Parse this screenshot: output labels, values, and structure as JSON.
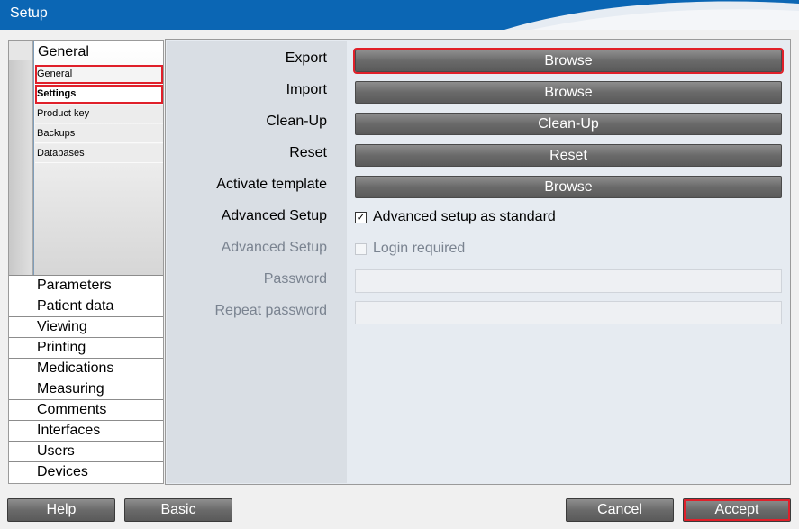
{
  "window": {
    "title": "Setup"
  },
  "nav": {
    "group_title": "General",
    "sub_items": [
      "General",
      "Settings",
      "Product key",
      "Backups",
      "Databases"
    ],
    "items": [
      "Parameters",
      "Patient data",
      "Viewing",
      "Printing",
      "Medications",
      "Measuring",
      "Comments",
      "Interfaces",
      "Users",
      "Devices"
    ]
  },
  "form": {
    "rows": [
      {
        "label": "Export",
        "button": "Browse"
      },
      {
        "label": "Import",
        "button": "Browse"
      },
      {
        "label": "Clean-Up",
        "button": "Clean-Up"
      },
      {
        "label": "Reset",
        "button": "Reset"
      },
      {
        "label": "Activate template",
        "button": "Browse"
      }
    ],
    "advanced_setup_label": "Advanced Setup",
    "advanced_setup_checkbox": "Advanced setup as standard",
    "advanced_setup_checked": true,
    "login_label": "Advanced Setup",
    "login_checkbox": "Login required",
    "login_checked": false,
    "password_label": "Password",
    "password_value": "",
    "repeat_password_label": "Repeat password",
    "repeat_password_value": ""
  },
  "footer": {
    "help": "Help",
    "basic": "Basic",
    "cancel": "Cancel",
    "accept": "Accept"
  },
  "colors": {
    "titlebar": "#0b66b4",
    "highlight": "#e0202a"
  }
}
